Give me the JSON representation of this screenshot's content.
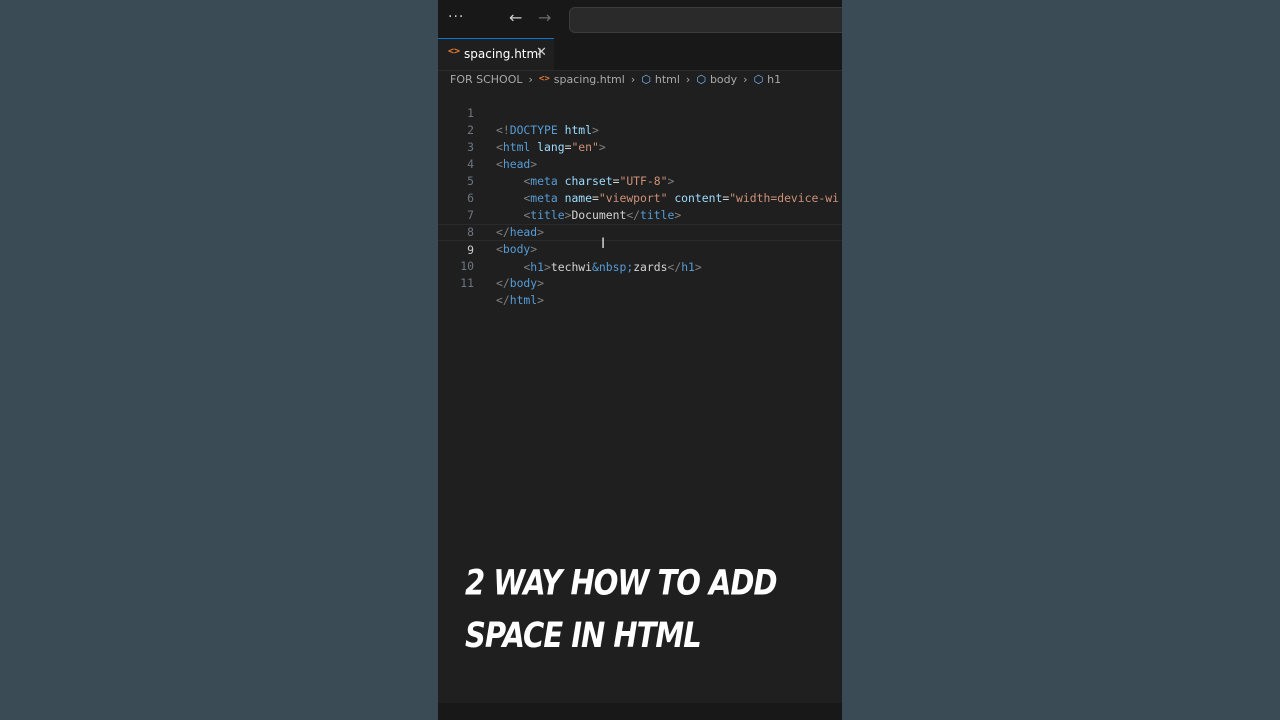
{
  "titlebar": {
    "menu_label": "···",
    "back_icon": "arrow-left-icon",
    "forward_icon": "arrow-right-icon"
  },
  "tab": {
    "label": "spacing.html",
    "icon": "html-file-icon",
    "close_icon": "close-icon"
  },
  "breadcrumb": {
    "items": [
      "FOR SCHOOL",
      "spacing.html",
      "html",
      "body",
      "h1"
    ]
  },
  "editor": {
    "lines": [
      {
        "num": "1"
      },
      {
        "num": "2"
      },
      {
        "num": "3"
      },
      {
        "num": "4"
      },
      {
        "num": "5"
      },
      {
        "num": "6"
      },
      {
        "num": "7"
      },
      {
        "num": "8"
      },
      {
        "num": "9"
      },
      {
        "num": "10"
      },
      {
        "num": "11"
      }
    ],
    "tokens": {
      "doctype": "<!DOCTYPE html>",
      "html_open": "html",
      "lang_attr": "lang",
      "lang_val": "\"en\"",
      "head_open": "head",
      "meta": "meta",
      "charset_attr": "charset",
      "charset_val": "\"UTF-8\"",
      "name_attr": "name",
      "name_val": "\"viewport\"",
      "content_attr": "content",
      "content_val": "\"width=device-wi",
      "title_tag": "title",
      "title_text": "Document",
      "head_close": "head",
      "body_open": "body",
      "h1_tag": "h1",
      "h1_text_a": "techwi",
      "h1_entity": "&nbsp;",
      "h1_text_b": "zards",
      "body_close": "body",
      "html_close": "html"
    },
    "current_line": 9
  },
  "caption": {
    "line1": "2 WAY HOW TO ADD",
    "line2": "SPACE IN HTML"
  }
}
